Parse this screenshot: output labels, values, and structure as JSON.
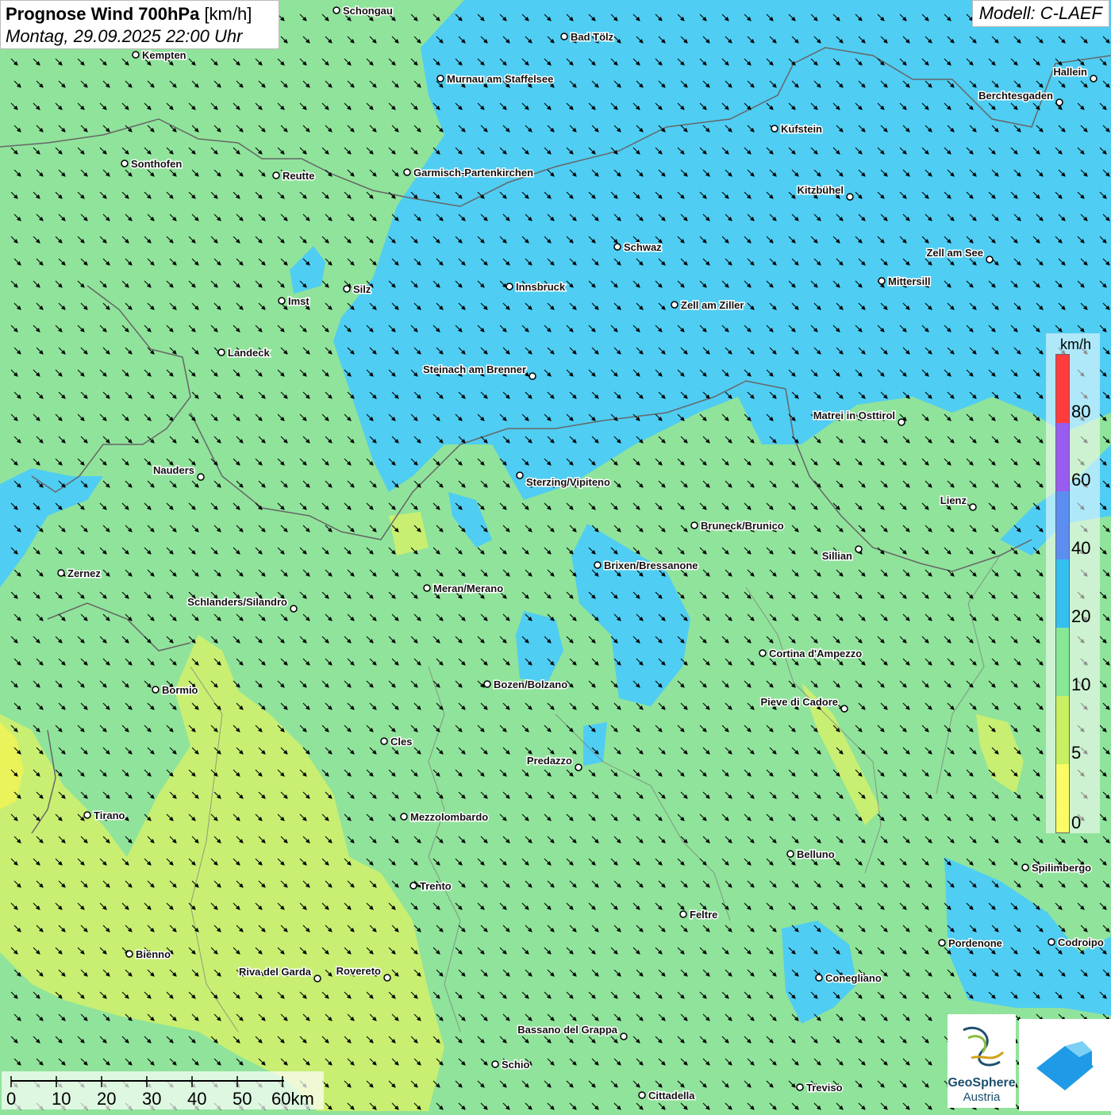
{
  "header": {
    "title_bold": "Prognose Wind 700hPa",
    "title_unit": "[km/h]",
    "datetime": "Montag, 29.09.2025 22:00 Uhr",
    "model": "Modell: C-LAEF"
  },
  "legend": {
    "unit": "km/h",
    "labels": [
      "80",
      "60",
      "40",
      "20",
      "10",
      "5",
      "0"
    ],
    "colors": [
      "#ff3b3b",
      "#9a5cf0",
      "#5b8ef0",
      "#33c0f0",
      "#86e894",
      "#c9f060",
      "#fbfb63"
    ]
  },
  "scalebar": {
    "labels": [
      "0",
      "10",
      "20",
      "30",
      "40",
      "50",
      "60km"
    ]
  },
  "logos": {
    "geosphere_line1": "GeoSphere",
    "geosphere_line2": "Austria"
  },
  "cities": [
    {
      "name": "Schongau"
    },
    {
      "name": "Bad Tölz"
    },
    {
      "name": "Kempten"
    },
    {
      "name": "Murnau am Staffelsee"
    },
    {
      "name": "Hallein"
    },
    {
      "name": "Berchtesgaden"
    },
    {
      "name": "Kufstein"
    },
    {
      "name": "Sonthofen"
    },
    {
      "name": "Reutte"
    },
    {
      "name": "Garmisch-Partenkirchen"
    },
    {
      "name": "Kitzbühel"
    },
    {
      "name": "Schwaz"
    },
    {
      "name": "Zell am See"
    },
    {
      "name": "Innsbruck"
    },
    {
      "name": "Mittersill"
    },
    {
      "name": "Silz"
    },
    {
      "name": "Imst"
    },
    {
      "name": "Zell am Ziller"
    },
    {
      "name": "Landeck"
    },
    {
      "name": "Steinach am Brenner"
    },
    {
      "name": "Matrei in Osttirol"
    },
    {
      "name": "Nauders"
    },
    {
      "name": "Sterzing/Vipiteno"
    },
    {
      "name": "Lienz"
    },
    {
      "name": "Bruneck/Brunico"
    },
    {
      "name": "Sillian"
    },
    {
      "name": "Zernez"
    },
    {
      "name": "Brixen/Bressanone"
    },
    {
      "name": "Meran/Merano"
    },
    {
      "name": "Schlanders/Silandro"
    },
    {
      "name": "Cortina d'Ampezzo"
    },
    {
      "name": "Bozen/Bolzano"
    },
    {
      "name": "Bormio"
    },
    {
      "name": "Pieve di Cadore"
    },
    {
      "name": "Cles"
    },
    {
      "name": "Predazzo"
    },
    {
      "name": "Tirano"
    },
    {
      "name": "Mezzolombardo"
    },
    {
      "name": "Belluno"
    },
    {
      "name": "Spilimbergo"
    },
    {
      "name": "Trento"
    },
    {
      "name": "Feltre"
    },
    {
      "name": "Pordenone"
    },
    {
      "name": "Codroipo"
    },
    {
      "name": "Bienno"
    },
    {
      "name": "Riva del Garda"
    },
    {
      "name": "Rovereto"
    },
    {
      "name": "Conegliano"
    },
    {
      "name": "Bassano del Grappa"
    },
    {
      "name": "Schio"
    },
    {
      "name": "Treviso"
    },
    {
      "name": "Cittadella"
    }
  ],
  "scalebar_small": "0"
}
